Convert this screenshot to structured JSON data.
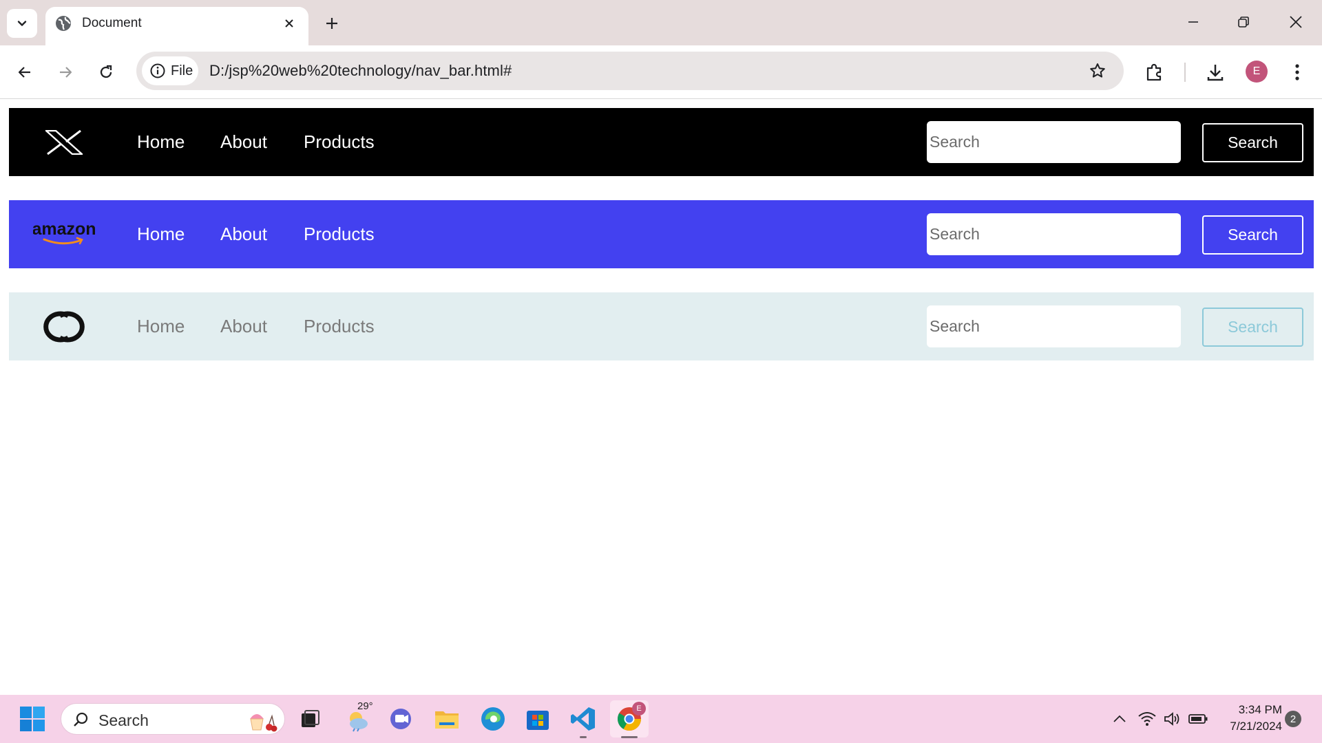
{
  "browser": {
    "tab_title": "Document",
    "url_scheme_label": "File",
    "url": "D:/jsp%20web%20technology/nav_bar.html#",
    "profile_initial": "E"
  },
  "navbars": [
    {
      "logo": "x-logo",
      "bg_color": "#000000",
      "links": [
        "Home",
        "About",
        "Products"
      ],
      "search_placeholder": "Search",
      "search_button": "Search"
    },
    {
      "logo": "amazon-logo",
      "logo_text": "amazon",
      "bg_color": "#4341f0",
      "links": [
        "Home",
        "About",
        "Products"
      ],
      "search_placeholder": "Search",
      "search_button": "Search"
    },
    {
      "logo": "chanel-logo",
      "bg_color": "#e2eef0",
      "links": [
        "Home",
        "About",
        "Products"
      ],
      "search_placeholder": "Search",
      "search_button": "Search"
    }
  ],
  "taskbar": {
    "search_label": "Search",
    "weather_temp": "29°",
    "time": "3:34 PM",
    "date": "7/21/2024",
    "notification_count": "2",
    "chrome_badge": "E"
  }
}
